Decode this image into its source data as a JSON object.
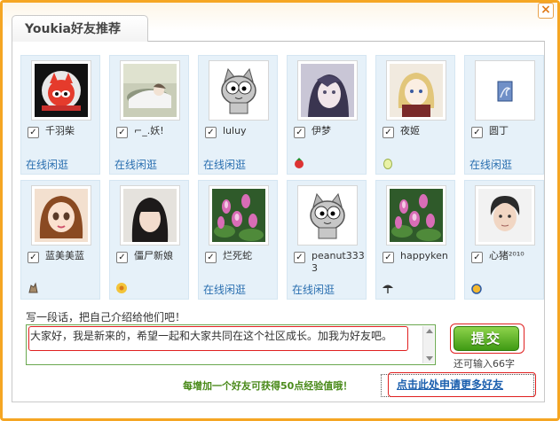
{
  "dialog": {
    "title": "Youkia好友推荐",
    "close_glyph": "×"
  },
  "friends": [
    {
      "name": "千羽柴",
      "status": "在线闲逛",
      "avatar": "fox-logo-avatar"
    },
    {
      "name": "⌐_.妖!",
      "status": "在线闲逛",
      "avatar": "anime-girl-avatar"
    },
    {
      "name": "luluy",
      "status": "在线闲逛",
      "avatar": "default-cat-avatar"
    },
    {
      "name": "伊梦",
      "status": "",
      "avatar": "anime-purple-avatar",
      "badge": "red-bag-badge"
    },
    {
      "name": "夜姬",
      "status": "",
      "avatar": "blonde-anime-avatar",
      "badge": "egg-badge"
    },
    {
      "name": "圆丁",
      "status": "在线闲逛",
      "avatar": "dragon-card-avatar"
    },
    {
      "name": "蓝美美蓝",
      "status": "",
      "avatar": "cartoon-girl-avatar",
      "badge": "squirrel-badge"
    },
    {
      "name": "僵尸新娘",
      "status": "",
      "avatar": "photo-woman-avatar",
      "badge": "flower-badge"
    },
    {
      "name": "烂死蛇",
      "status": "在线闲逛",
      "avatar": "lotus-avatar"
    },
    {
      "name": "peanut3333",
      "status": "在线闲逛",
      "avatar": "default-cat-avatar"
    },
    {
      "name": "happyken",
      "status": "",
      "avatar": "lotus-avatar",
      "badge": "dark-umbrella-badge"
    },
    {
      "name": "心猪²⁰¹⁰",
      "status": "",
      "avatar": "photo-boy-avatar",
      "badge": "blue-bag-badge"
    }
  ],
  "intro": {
    "label": "写一段话，把自己介绍给他们吧！",
    "text": "大家好，我是新来的，希望一起和大家共同在这个社区成长。加我为好友吧。"
  },
  "submit": {
    "label": "提交",
    "chars_left": "还可输入66字"
  },
  "footer": {
    "bonus": "每增加一个好友可获得50点经验值哦！",
    "more_link": "点击此处申请更多好友"
  },
  "colors": {
    "frame": "#f5a623",
    "card_bg": "#e6f1f9",
    "link": "#2a6fb0",
    "submit_green": "#3f9a14",
    "highlight_red": "#e02020"
  }
}
